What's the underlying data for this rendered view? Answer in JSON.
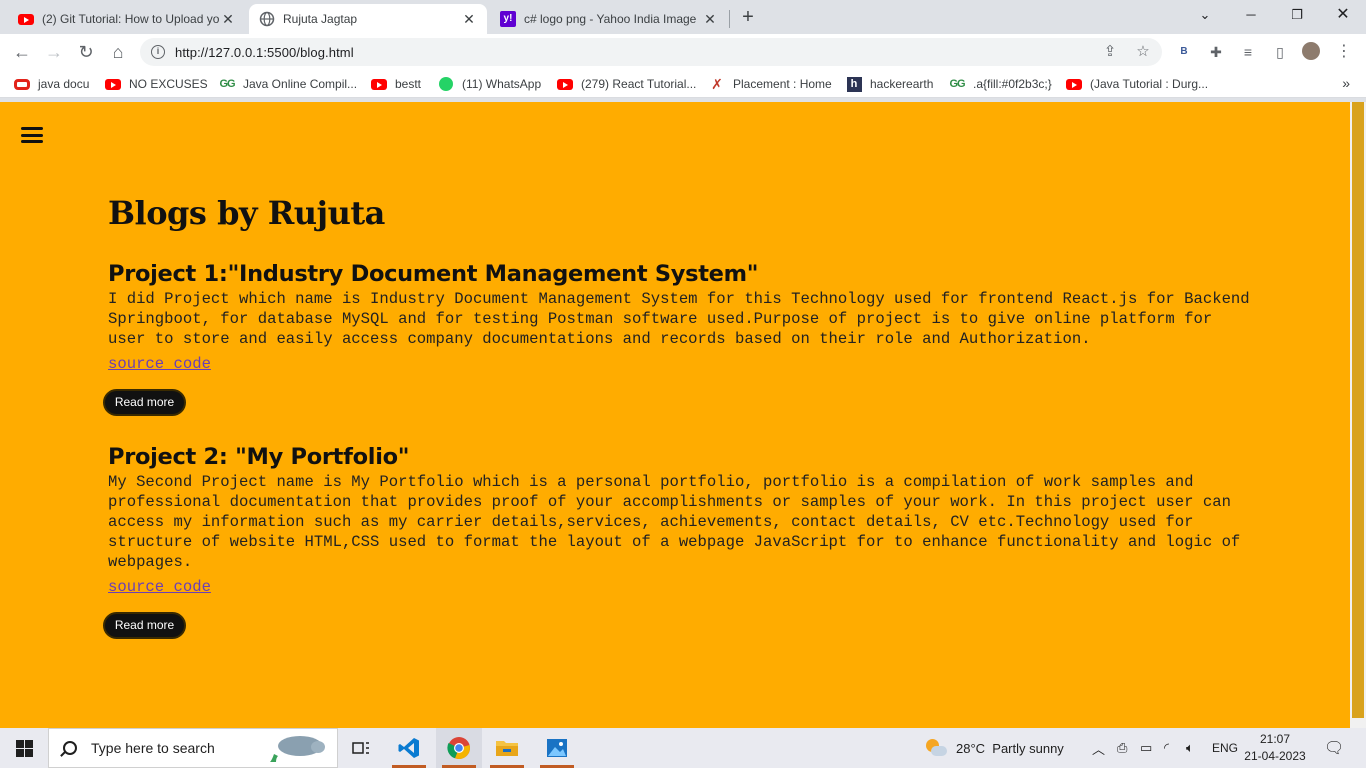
{
  "browser": {
    "tabs": [
      {
        "title": "(2) Git Tutorial: How to Upload yo",
        "icon": "youtube-icon",
        "active": false
      },
      {
        "title": "Rujuta Jagtap",
        "icon": "globe-icon",
        "active": true
      },
      {
        "title": "c# logo png - Yahoo India Image",
        "icon": "yahoo-icon",
        "active": false
      }
    ],
    "new_tab": "+",
    "url": "http://127.0.0.1:5500/blog.html",
    "profile_initial": "B"
  },
  "bookmarks": [
    {
      "label": "java docu",
      "icon": "oracle-icon"
    },
    {
      "label": "NO EXCUSES",
      "icon": "youtube-icon"
    },
    {
      "label": "Java Online Compil...",
      "icon": "geeksforgeeks-icon"
    },
    {
      "label": "bestt",
      "icon": "youtube-icon"
    },
    {
      "label": "(11) WhatsApp",
      "icon": "whatsapp-icon"
    },
    {
      "label": "(279) React Tutorial...",
      "icon": "youtube-icon"
    },
    {
      "label": "Placement : Home",
      "icon": "runner-icon"
    },
    {
      "label": "hackerearth",
      "icon": "hackerearth-icon"
    },
    {
      "label": ".a{fill:#0f2b3c;}",
      "icon": "geeksforgeeks-icon"
    },
    {
      "label": "(Java Tutorial : Durg...",
      "icon": "youtube-icon"
    }
  ],
  "page": {
    "title": "Blogs by Rujuta",
    "background": "#ffac00",
    "projects": [
      {
        "heading": "Project 1:\"Industry Document Management System\"",
        "body": "I did Project which name is Industry Document Management System for this Technology used for frontend React.js for Backend Springboot, for database MySQL and for testing Postman software used.Purpose of project is to give online platform for user to store and easily access company documentations and records based on their role and Authorization.",
        "link": "source code",
        "button": "Read more"
      },
      {
        "heading": "Project 2: \"My Portfolio\"",
        "body": "My Second Project name is My Portfolio which is a personal portfolio, portfolio is a compilation of work samples and professional documentation that provides proof of your accomplishments or samples of your work. In this project user can access my information such as my carrier details,services, achievements, contact details, CV etc.Technology used for structure of website HTML,CSS used to format the layout of a webpage JavaScript for to enhance functionality and logic of webpages.",
        "link": "source code",
        "button": "Read more"
      }
    ]
  },
  "taskbar": {
    "search_placeholder": "Type here to search",
    "weather": "28°C  Partly sunny",
    "language": "ENG",
    "time": "21:07",
    "date": "21-04-2023"
  }
}
